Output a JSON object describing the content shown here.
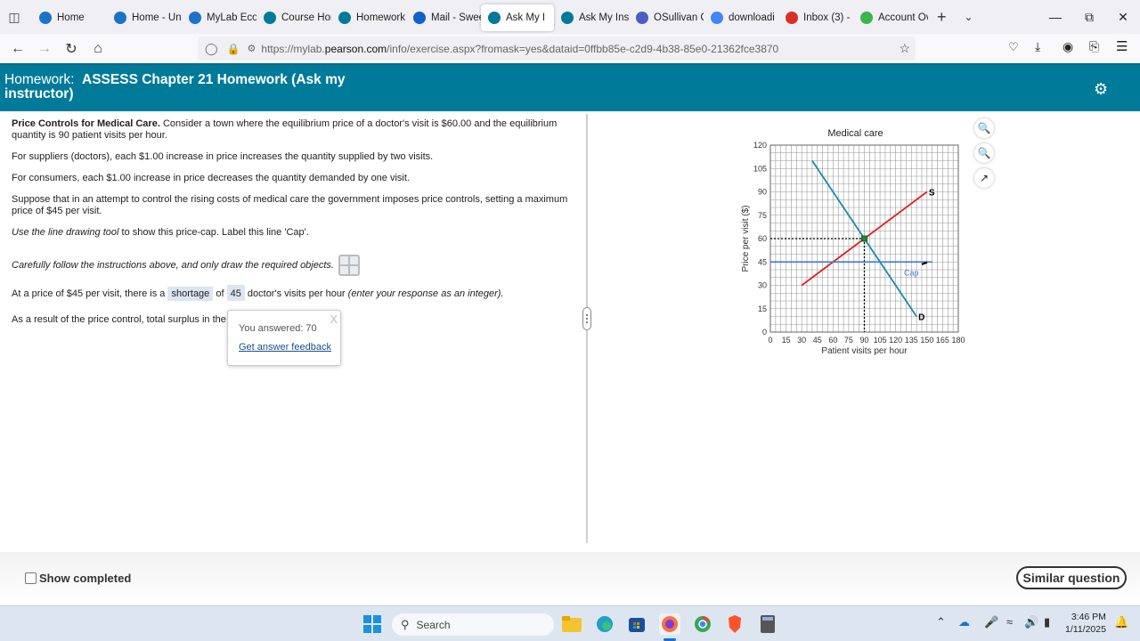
{
  "browser": {
    "tabs": [
      {
        "label": "Home",
        "icon": "mylab-icon",
        "color": "#1a73c8"
      },
      {
        "label": "Home - Un",
        "icon": "mylab-icon",
        "color": "#1a73c8"
      },
      {
        "label": "MyLab Eco",
        "icon": "mylab-icon",
        "color": "#1a73c8"
      },
      {
        "label": "Course Hon",
        "icon": "pearson-icon",
        "color": "#007a99"
      },
      {
        "label": "Homework",
        "icon": "pearson-icon",
        "color": "#007a99"
      },
      {
        "label": "Mail - Swee",
        "icon": "outlook-icon",
        "color": "#0f62c7"
      },
      {
        "label": "Ask My I",
        "icon": "pearson-icon",
        "color": "#007a99",
        "active": true
      },
      {
        "label": "Ask My Inst",
        "icon": "pearson-icon",
        "color": "#007a99"
      },
      {
        "label": "OSullivan C",
        "icon": "gear-logo-icon",
        "color": "#4a5fc1"
      },
      {
        "label": "downloadi",
        "icon": "google-icon",
        "color": "#4285f4"
      },
      {
        "label": "Inbox (3) -",
        "icon": "gmail-icon",
        "color": "#d93025"
      },
      {
        "label": "Account Ov",
        "icon": "play-icon",
        "color": "#3bb54a"
      }
    ],
    "url_prefix": "https://mylab.",
    "url_domain": "pearson.com",
    "url_rest": "/info/exercise.aspx?fromask=yes&dataid=0ffbb85e-c2d9-4b38-85e0-21362fce3870"
  },
  "header": {
    "prefix": "Homework:",
    "title": "ASSESS Chapter 21 Homework (Ask my instructor)"
  },
  "question": {
    "intro_bold": "Price Controls for Medical Care.",
    "intro_text": " Consider a town where the equilibrium price of a doctor's visit is $60.00 and the equilibrium quantity is 90 patient visits per hour.",
    "p2": "For suppliers (doctors), each $1.00 increase in price increases the quantity supplied by two visits.",
    "p3": "For consumers, each $1.00 increase in price decreases the quantity demanded by one visit.",
    "p4": "Suppose that in an attempt to control the rising costs of medical care the government imposes price controls, setting a maximum price of $45 per visit.",
    "p5_italic": "Use the line drawing tool",
    "p5_text": " to show this price-cap. Label this line 'Cap'.",
    "p6_italic": "Carefully follow the instructions above, and only draw the required objects.",
    "p7_a": "At a price of $45 per visit, there is a ",
    "p7_select": "shortage",
    "p7_b": " of ",
    "p7_input": "45",
    "p7_c": " doctor's visits per hour ",
    "p7_italic": "(enter your response as an integer).",
    "p8": "As a result of the price control, total surplus in the"
  },
  "popup": {
    "answered": "You answered: 70",
    "feedback_link": "Get answer feedback",
    "close": "X"
  },
  "chart_data": {
    "type": "line",
    "title": "Medical care",
    "xlabel": "Patient visits per hour",
    "ylabel": "Price per visit ($)",
    "xlim": [
      0,
      180
    ],
    "ylim": [
      0,
      120
    ],
    "xticks": [
      0,
      15,
      30,
      45,
      60,
      75,
      90,
      105,
      120,
      135,
      150,
      165,
      180
    ],
    "yticks": [
      0,
      15,
      30,
      45,
      60,
      75,
      90,
      105,
      120
    ],
    "grid": true,
    "series": [
      {
        "name": "D",
        "color": "#1a8ab0",
        "points": [
          [
            40,
            110
          ],
          [
            140,
            10
          ]
        ]
      },
      {
        "name": "S",
        "color": "#e02020",
        "points": [
          [
            30,
            30
          ],
          [
            150,
            90
          ]
        ]
      },
      {
        "name": "Cap",
        "color": "#4a7fd6",
        "points": [
          [
            0,
            45
          ],
          [
            155,
            45
          ]
        ]
      }
    ],
    "equilibrium": {
      "x": 90,
      "y": 60
    },
    "annotations": [
      "S",
      "D",
      "Cap"
    ]
  },
  "footer": {
    "show_completed": "Show completed",
    "similar_question": "Similar question"
  },
  "taskbar": {
    "search_placeholder": "Search",
    "time": "3:46 PM",
    "date": "1/11/2025"
  }
}
